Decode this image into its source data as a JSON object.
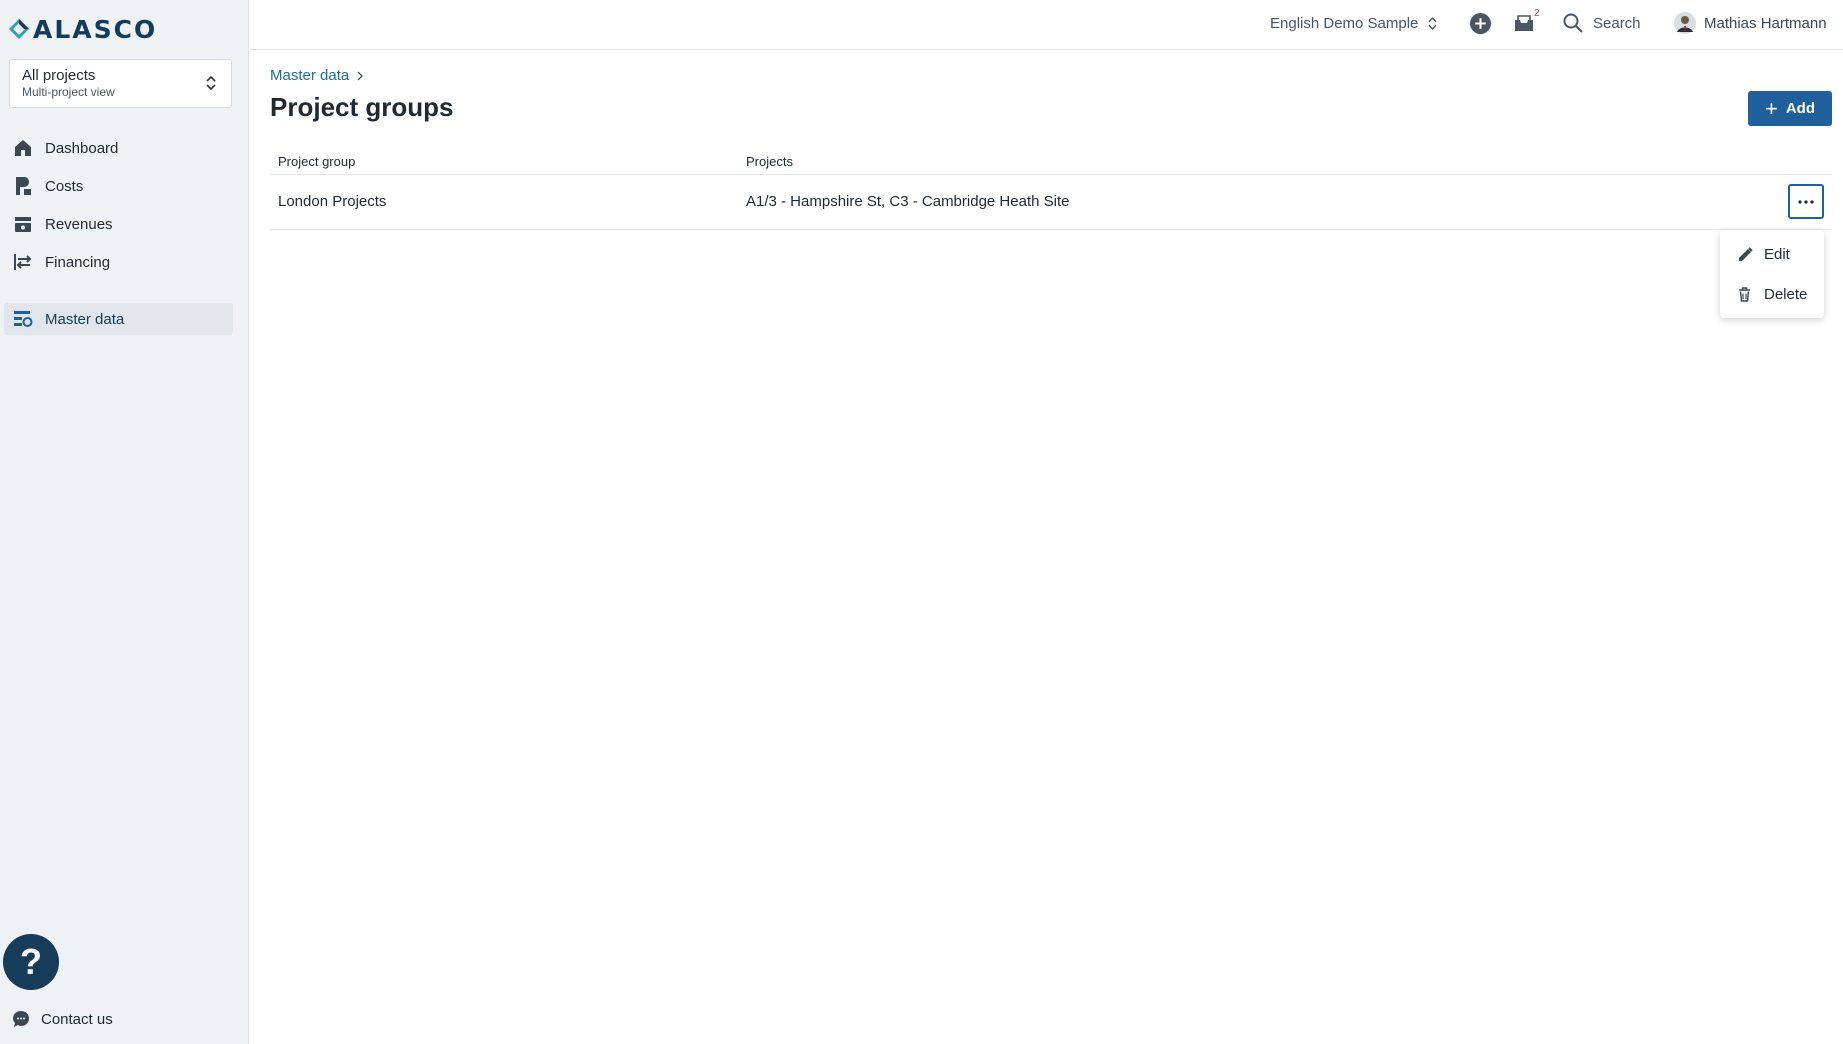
{
  "brand": {
    "name": "ALASCO"
  },
  "project_selector": {
    "title": "All projects",
    "subtitle": "Multi-project view"
  },
  "sidebar": {
    "items": [
      {
        "label": "Dashboard",
        "icon": "home-icon"
      },
      {
        "label": "Costs",
        "icon": "costs-icon"
      },
      {
        "label": "Revenues",
        "icon": "revenues-icon"
      },
      {
        "label": "Financing",
        "icon": "financing-icon"
      },
      {
        "label": "Master data",
        "icon": "master-data-icon",
        "active": true
      }
    ],
    "help_label": "?",
    "contact_label": "Contact us"
  },
  "topbar": {
    "workspace": "English Demo Sample",
    "notifications_count": "2",
    "search_label": "Search",
    "user_name": "Mathias Hartmann"
  },
  "breadcrumb": {
    "parent": "Master data"
  },
  "page": {
    "title": "Project groups",
    "add_label": "Add"
  },
  "table": {
    "headers": [
      "Project group",
      "Projects"
    ],
    "rows": [
      {
        "group": "London Projects",
        "projects": "A1/3 - Hampshire St, C3 - Cambridge Heath Site"
      }
    ]
  },
  "row_menu": {
    "items": [
      {
        "label": "Edit",
        "icon": "pencil-icon"
      },
      {
        "label": "Delete",
        "icon": "trash-icon"
      }
    ]
  },
  "colors": {
    "primary": "#1e5f9c",
    "sidebar_bg": "#eff2f5",
    "link": "#1e6aa8",
    "badge": "#e0393e"
  }
}
